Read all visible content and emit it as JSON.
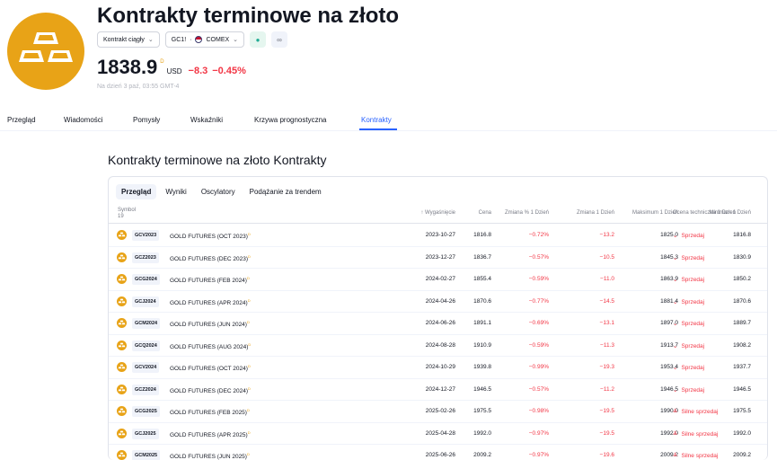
{
  "header": {
    "title": "Kontrakty terminowe na złoto",
    "chips": {
      "contract_type": "Kontrakt ciągły",
      "symbol": "GC1!",
      "exchange": "COMEX"
    },
    "price": "1838.9",
    "price_sup": "D",
    "currency": "USD",
    "change_abs": "−8.3",
    "change_pct": "−0.45%",
    "as_of": "Na dzień 3 paź, 03:55 GMT-4"
  },
  "tabs": [
    "Przegląd",
    "Wiadomości",
    "Pomysły",
    "Wskaźniki",
    "Krzywa prognostyczna",
    "Kontrakty"
  ],
  "active_tab": "Kontrakty",
  "section_title": "Kontrakty terminowe na złoto Kontrakty",
  "subtabs": [
    "Przegląd",
    "Wyniki",
    "Oscylatory",
    "Podążanie za trendem"
  ],
  "active_subtab": "Przegląd",
  "table": {
    "symbol_header": "Symbol",
    "symbol_count": "19",
    "headers": {
      "expiration": "↑ Wygaśnięcie",
      "price": "Cena",
      "change_pct": "Zmiana % 1 Dzień",
      "change": "Zmiana 1 Dzień",
      "high": "Maksimum 1 Dzień",
      "low": "Minimum 1 Dzień",
      "rating": "Ocena techniczna 1 Dzień"
    },
    "rows": [
      {
        "ticker": "GCV2023",
        "name": "GOLD FUTURES (OCT 2023)",
        "sup": "D",
        "exp": "2023-10-27",
        "price": "1816.8",
        "chg_pct": "−0.72%",
        "chg": "−13.2",
        "high": "1825.0",
        "low": "1816.8",
        "arrow": "⌄",
        "rating": "Sprzedaj"
      },
      {
        "ticker": "GCZ2023",
        "name": "GOLD FUTURES (DEC 2023)",
        "sup": "D",
        "exp": "2023-12-27",
        "price": "1836.7",
        "chg_pct": "−0.57%",
        "chg": "−10.5",
        "high": "1845.3",
        "low": "1830.9",
        "arrow": "⌄",
        "rating": "Sprzedaj"
      },
      {
        "ticker": "GCG2024",
        "name": "GOLD FUTURES (FEB 2024)",
        "sup": "D",
        "exp": "2024-02-27",
        "price": "1855.4",
        "chg_pct": "−0.59%",
        "chg": "−11.0",
        "high": "1863.9",
        "low": "1850.2",
        "arrow": "⌄",
        "rating": "Sprzedaj"
      },
      {
        "ticker": "GCJ2024",
        "name": "GOLD FUTURES (APR 2024)",
        "sup": "D",
        "exp": "2024-04-26",
        "price": "1870.6",
        "chg_pct": "−0.77%",
        "chg": "−14.5",
        "high": "1881.4",
        "low": "1870.6",
        "arrow": "⌄",
        "rating": "Sprzedaj"
      },
      {
        "ticker": "GCM2024",
        "name": "GOLD FUTURES (JUN 2024)",
        "sup": "D",
        "exp": "2024-06-26",
        "price": "1891.1",
        "chg_pct": "−0.69%",
        "chg": "−13.1",
        "high": "1897.0",
        "low": "1889.7",
        "arrow": "⌄",
        "rating": "Sprzedaj"
      },
      {
        "ticker": "GCQ2024",
        "name": "GOLD FUTURES (AUG 2024)",
        "sup": "D",
        "exp": "2024-08-28",
        "price": "1910.9",
        "chg_pct": "−0.59%",
        "chg": "−11.3",
        "high": "1913.7",
        "low": "1908.2",
        "arrow": "⌄",
        "rating": "Sprzedaj"
      },
      {
        "ticker": "GCV2024",
        "name": "GOLD FUTURES (OCT 2024)",
        "sup": "D",
        "exp": "2024-10-29",
        "price": "1939.8",
        "chg_pct": "−0.99%",
        "chg": "−19.3",
        "high": "1953.4",
        "low": "1937.7",
        "arrow": "⌄",
        "rating": "Sprzedaj"
      },
      {
        "ticker": "GCZ2024",
        "name": "GOLD FUTURES (DEC 2024)",
        "sup": "D",
        "exp": "2024-12-27",
        "price": "1946.5",
        "chg_pct": "−0.57%",
        "chg": "−11.2",
        "high": "1946.5",
        "low": "1946.5",
        "arrow": "⌄",
        "rating": "Sprzedaj"
      },
      {
        "ticker": "GCG2025",
        "name": "GOLD FUTURES (FEB 2025)",
        "sup": "D",
        "exp": "2025-02-26",
        "price": "1975.5",
        "chg_pct": "−0.98%",
        "chg": "−19.5",
        "high": "1990.0",
        "low": "1975.5",
        "arrow": "≚",
        "rating": "Silne sprzedaj"
      },
      {
        "ticker": "GCJ2025",
        "name": "GOLD FUTURES (APR 2025)",
        "sup": "D",
        "exp": "2025-04-28",
        "price": "1992.0",
        "chg_pct": "−0.97%",
        "chg": "−19.5",
        "high": "1992.0",
        "low": "1992.0",
        "arrow": "≚",
        "rating": "Silne sprzedaj"
      },
      {
        "ticker": "GCM2025",
        "name": "GOLD FUTURES (JUN 2025)",
        "sup": "D",
        "exp": "2025-06-26",
        "price": "2009.2",
        "chg_pct": "−0.97%",
        "chg": "−19.6",
        "high": "2009.2",
        "low": "2009.2",
        "arrow": "≚",
        "rating": "Silne sprzedaj"
      }
    ]
  },
  "colors": {
    "accent": "#2962ff",
    "negative": "#f23645",
    "gold": "#e8a317"
  }
}
